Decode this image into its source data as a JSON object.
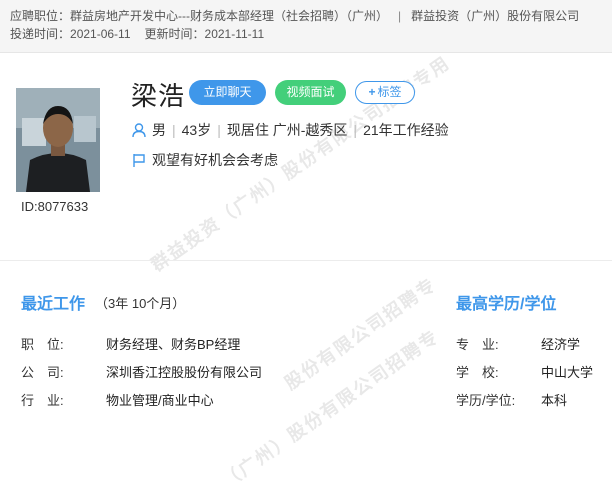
{
  "header": {
    "position_label": "应聘职位：",
    "position": "群益房地产开发中心---财务成本部经理（社会招聘）（广州）",
    "separator": "|",
    "company": "群益投资（广州）股份有限公司",
    "submitted_label": "投递时间：",
    "submitted": "2021-06-11",
    "updated_label": "更新时间：",
    "updated": "2021-11-11"
  },
  "candidate": {
    "name": "梁浩",
    "id_text": "ID:8077633",
    "gender": "男",
    "age": "43岁",
    "residence": "现居住 广州-越秀区",
    "experience": "21年工作经验",
    "job_status": "观望有好机会会考虑"
  },
  "actions": {
    "chat": "立即聊天",
    "video": "视频面试",
    "tag": "标签",
    "tag_symbol": "+"
  },
  "recent_work": {
    "title": "最近工作",
    "duration": "（3年 10个月）",
    "rows": [
      {
        "label": "职　位:",
        "value": "财务经理、财务BP经理"
      },
      {
        "label": "公　司:",
        "value": "深圳香江控股股份有限公司"
      },
      {
        "label": "行　业:",
        "value": "物业管理/商业中心"
      }
    ]
  },
  "education": {
    "title": "最高学历/学位",
    "rows": [
      {
        "label": "专　业:",
        "value": "经济学"
      },
      {
        "label": "学　校:",
        "value": "中山大学"
      },
      {
        "label": "学历/学位:",
        "value": "本科"
      }
    ]
  },
  "watermarks": {
    "w1": "群益投资（广州）股份有限公司招聘专用",
    "w2": "股份有限公司招聘专",
    "w3": "（广州）股份有限公司招聘专"
  },
  "colors": {
    "accent": "#3f97ea",
    "video": "#43cf7a"
  }
}
